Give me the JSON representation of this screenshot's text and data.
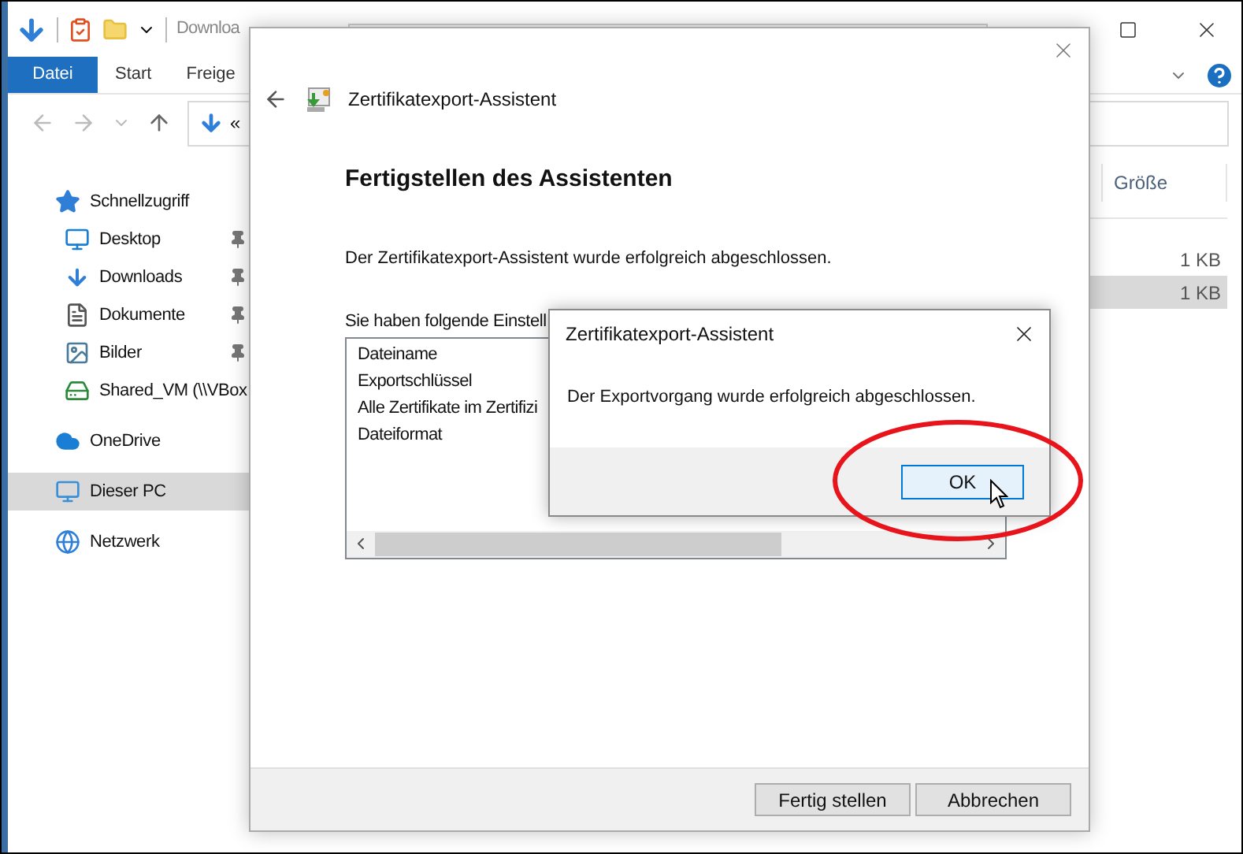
{
  "explorer": {
    "title": "Downloa",
    "tabs": [
      {
        "label": "Datei",
        "selected": true
      },
      {
        "label": "Start",
        "selected": false
      },
      {
        "label": "Freige",
        "selected": false
      }
    ],
    "address": {
      "crumb": "«"
    },
    "sidebar": {
      "items": [
        {
          "kind": "quick",
          "label": "Schnellzugriff",
          "selected": false,
          "children": [
            {
              "kind": "desktop",
              "label": "Desktop",
              "pinned": true,
              "selected": false
            },
            {
              "kind": "downloads",
              "label": "Downloads",
              "pinned": true,
              "selected": false
            },
            {
              "kind": "documents",
              "label": "Dokumente",
              "pinned": true,
              "selected": false
            },
            {
              "kind": "pictures",
              "label": "Bilder",
              "pinned": true,
              "selected": false
            },
            {
              "kind": "drive",
              "label": "Shared_VM (\\\\VBox",
              "selected": false
            }
          ]
        },
        {
          "kind": "cloud",
          "label": "OneDrive",
          "selected": false
        },
        {
          "kind": "pc",
          "label": "Dieser PC",
          "selected": true
        },
        {
          "kind": "network",
          "label": "Netzwerk",
          "selected": false
        }
      ]
    },
    "table": {
      "columns": [
        "Größe"
      ],
      "rows": [
        {
          "size": "1 KB",
          "selected": false
        },
        {
          "size": "1 KB",
          "selected": true
        }
      ]
    }
  },
  "wizard": {
    "title": "Zertifikatexport-Assistent",
    "heading": "Fertigstellen des Assistenten",
    "message": "Der Zertifikatexport-Assistent wurde erfolgreich abgeschlossen.",
    "settings_label": "Sie haben folgende Einstell",
    "settings": [
      "Dateiname",
      "Exportschlüssel",
      "Alle Zertifikate im Zertifizi",
      "Dateiformat"
    ],
    "buttons": [
      "Fertig stellen",
      "Abbrechen"
    ]
  },
  "dialog": {
    "title": "Zertifikatexport-Assistent",
    "message": "Der Exportvorgang wurde erfolgreich abgeschlossen.",
    "button": "OK"
  }
}
